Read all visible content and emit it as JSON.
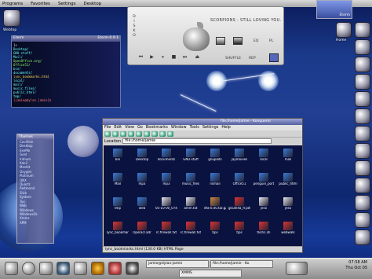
{
  "top_panel": {
    "items": [
      "Programs",
      "Favorites",
      "Settings",
      "Desktop"
    ]
  },
  "desktop_icons": [
    {
      "label": "Webtop"
    },
    {
      "label": "Home"
    }
  ],
  "terminal": {
    "title_left": "Eterm",
    "title_right": "Eterm-0.9.1",
    "lines": [
      {
        "t": "1s",
        "c": "c5"
      },
      {
        "t": "Desktop/",
        "c": "c2"
      },
      {
        "t": "GNU-stuff/",
        "c": "c2"
      },
      {
        "t": "Mail/",
        "c": "c2"
      },
      {
        "t": "OpenOffice.org/",
        "c": "c3"
      },
      {
        "t": "Office51/",
        "c": "c3"
      },
      {
        "t": "bin/",
        "c": "c2"
      },
      {
        "t": "documents/",
        "c": "c2"
      },
      {
        "t": "lync_bookmarks.html",
        "c": "c4"
      },
      {
        "t": "local/",
        "c": "c2"
      },
      {
        "t": "mail/",
        "c": "c2"
      },
      {
        "t": "music_files/",
        "c": "c2"
      },
      {
        "t": "public_html/",
        "c": "c2"
      },
      {
        "t": "tmp/",
        "c": "c2"
      },
      {
        "t": "[jamie@dylan jamie]$",
        "c": "c1"
      }
    ]
  },
  "player": {
    "song": "SCORPIONS - STILL LOVING YOU.",
    "side_letters": [
      "D",
      "I",
      "S",
      "K",
      "O"
    ],
    "labels": {
      "eq": "EQ",
      "pl": "PL",
      "shuffle": "SHUFFLE",
      "rep": "REP"
    },
    "controls": [
      "prev-icon",
      "play-icon",
      "pause-icon",
      "stop-icon",
      "next-icon",
      "eject-icon"
    ]
  },
  "themes": {
    "title": "Themes",
    "items": [
      "CoolSlim",
      "Desktop",
      "ExeMo",
      "Gold",
      "Iridium",
      "Kde2",
      "Mosfet",
      "Oxygen",
      "Platinum",
      "QNX",
      "Quartz",
      "Redmond",
      "Slick",
      "System",
      "Tux",
      "Web",
      "Windows",
      "Windows2k",
      "Xmms",
      "XPM"
    ]
  },
  "konqueror": {
    "title": "file:/home/jamie - Konqueror",
    "menu": [
      "File",
      "Edit",
      "View",
      "Go",
      "Bookmarks",
      "Window",
      "Tools",
      "Settings",
      "Help"
    ],
    "location_label": "Location",
    "location_value": "file:/home/jamie",
    "files": [
      {
        "name": "bin",
        "color": "#3b7bd6"
      },
      {
        "name": "Desktop",
        "color": "#3b7bd6"
      },
      {
        "name": "documents",
        "color": "#3b7bd6"
      },
      {
        "name": "GNU-stuff",
        "color": "#3b7bd6"
      },
      {
        "name": "gnuplots",
        "color": "#3b7bd6"
      },
      {
        "name": "jaymovies",
        "color": "#3b7bd6"
      },
      {
        "name": "local",
        "color": "#3b7bd6"
      },
      {
        "name": "mail",
        "color": "#3b7bd6"
      },
      {
        "name": "Mail",
        "color": "#3b7bd6"
      },
      {
        "name": "mp3",
        "color": "#3b7bd6"
      },
      {
        "name": "mp3",
        "color": "#3b7bd6"
      },
      {
        "name": "music_files",
        "color": "#3b7bd6"
      },
      {
        "name": "nsmail",
        "color": "#3b7bd6"
      },
      {
        "name": "Office51",
        "color": "#3b7bd6"
      },
      {
        "name": "penguin_port",
        "color": "#3b7bd6"
      },
      {
        "name": "public_html",
        "color": "#3b7bd6"
      },
      {
        "name": "tmp",
        "color": "#3b7bd6"
      },
      {
        "name": "web",
        "color": "#3b7bd6"
      },
      {
        "name": "05-10-00_074601_rb_screenshot",
        "color": "#e8e8f0"
      },
      {
        "name": "amm.txt",
        "color": "#e8e8f0"
      },
      {
        "name": "dfa-0.00.tar.gz",
        "color": "#c84"
      },
      {
        "name": "gnutella_fr.pdf",
        "color": "#d33"
      },
      {
        "name": "jeso",
        "color": "#e8e8f0"
      },
      {
        "name": "jeso",
        "color": "#e8e8f0"
      },
      {
        "name": "lync_bookmarks.html",
        "color": "#d33"
      },
      {
        "name": "Operacl.adr",
        "color": "#d33"
      },
      {
        "name": "rc.firewall.txt",
        "color": "#d33"
      },
      {
        "name": "rc.firewall.txt",
        "color": "#d33"
      },
      {
        "name": "tips",
        "color": "#d33"
      },
      {
        "name": "tips",
        "color": "#d33"
      },
      {
        "name": "tksh1.sh",
        "color": "#d33"
      },
      {
        "name": "webwalk",
        "color": "#d33"
      }
    ],
    "status": "lync_bookmarks.html (130.0 KB) HTML Page"
  },
  "taskbar": {
    "tasks": [
      "jamie@dylan:jamie",
      "file:/home/jamie - Ko",
      "XMMS"
    ],
    "clock_time": "07:58 AM",
    "clock_date": "Thu Oct 05"
  },
  "right_dock_icons": [
    "terminal-icon",
    "home-icon",
    "mail-icon",
    "browser-icon",
    "tools-icon",
    "chat-icon",
    "lock-icon",
    "tux-icon",
    "tux-icon",
    "print-icon",
    "tux-icon",
    "tux-icon",
    "trash-icon"
  ],
  "top_tile_label": "Eterm"
}
